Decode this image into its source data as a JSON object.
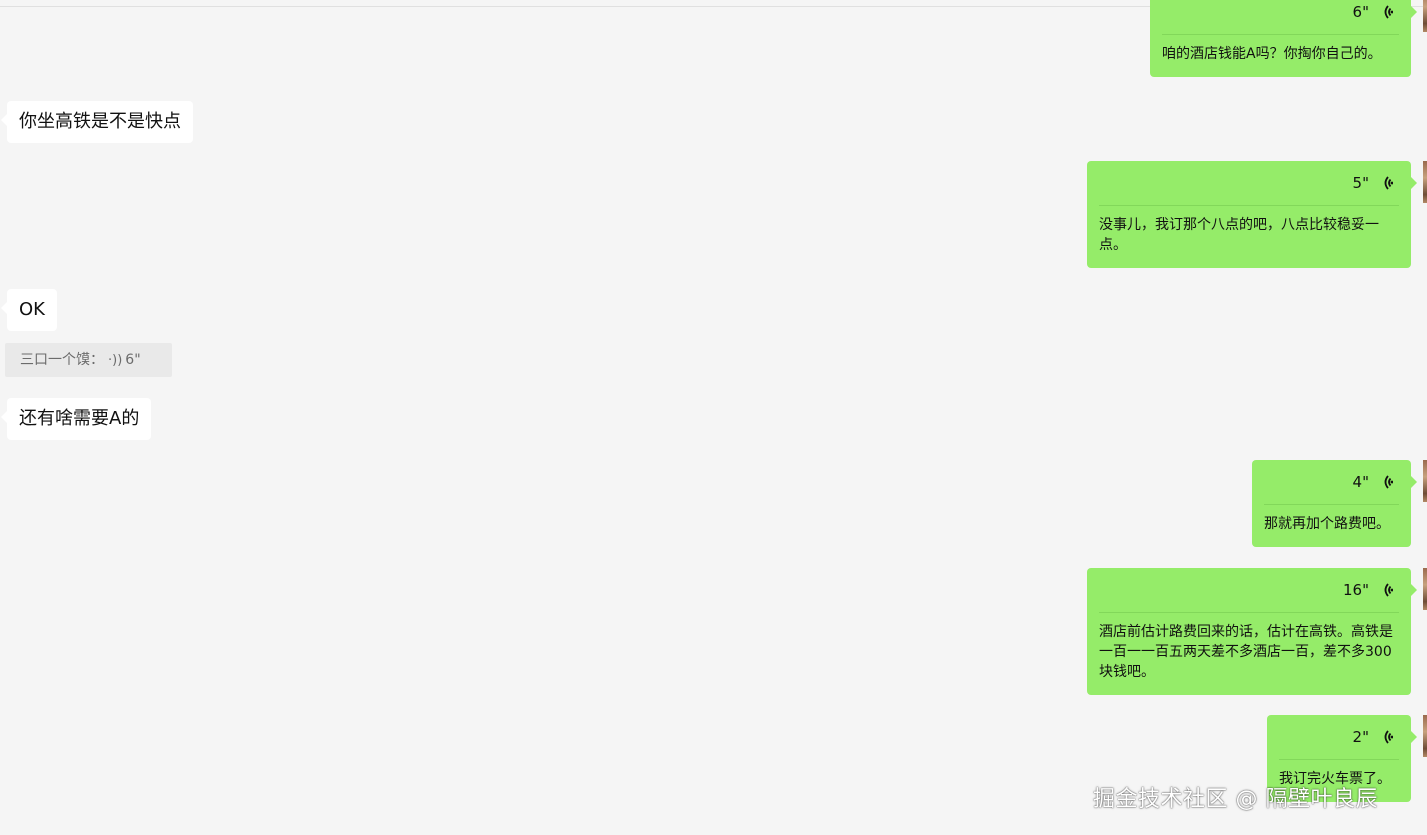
{
  "messages_incoming": [
    {
      "text": "你坐高铁是不是快点"
    },
    {
      "text": "OK"
    },
    {
      "text": "还有啥需要A的"
    }
  ],
  "collapsed_voice": {
    "sender": "三口一个馍：",
    "duration": "6\""
  },
  "messages_outgoing": [
    {
      "duration": "6\"",
      "text": "咱的酒店钱能A吗？你掏你自己的。"
    },
    {
      "duration": "5\"",
      "text": "没事儿，我订那个八点的吧，八点比较稳妥一点。"
    },
    {
      "duration": "4\"",
      "text": "那就再加个路费吧。"
    },
    {
      "duration": "16\"",
      "text": "酒店前估计路费回来的话，估计在高铁。高铁是一百一一百五两天差不多酒店一百，差不多300块钱吧。"
    },
    {
      "duration": "2\"",
      "text": "我订完火车票了。"
    }
  ],
  "icons": {
    "voice_wave": "voice-wave-icon"
  },
  "colors": {
    "background": "#f5f5f5",
    "incoming_bubble": "#ffffff",
    "outgoing_bubble": "#95ec69"
  },
  "watermark": "掘金技术社区 @ 隔壁叶良辰"
}
